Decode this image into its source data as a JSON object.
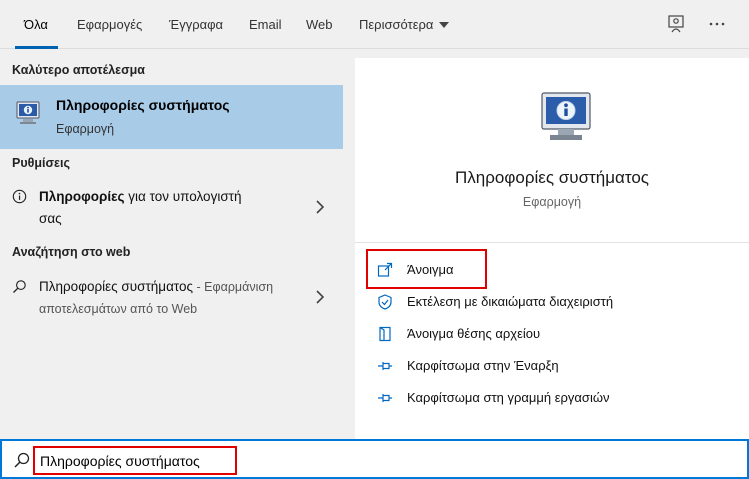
{
  "tabs": [
    {
      "label": "Όλα",
      "active": true
    },
    {
      "label": "Εφαρμογές"
    },
    {
      "label": "Έγγραφα"
    },
    {
      "label": "Email"
    },
    {
      "label": "Web"
    },
    {
      "label": "Περισσότερα"
    }
  ],
  "left": {
    "best_match_header": "Καλύτερο αποτέλεσμα",
    "best_match": {
      "title": "Πληροφορίες συστήματος",
      "subtitle": "Εφαρμογή"
    },
    "settings_header": "Ρυθμίσεις",
    "settings_item": {
      "bold": "Πληροφορίες",
      "rest": " για τον υπολογιστή",
      "line2": "σας"
    },
    "web_header": "Αναζήτηση στο web",
    "web_item": {
      "query": "Πληροφορίες συστήματος",
      "hint": " - Εφαρμάνιση",
      "line2": "αποτελεσμάτων από το Web"
    }
  },
  "right": {
    "title": "Πληροφορίες συστήματος",
    "subtitle": "Εφαρμογή",
    "actions": [
      {
        "label": "Άνοιγμα",
        "icon": "open-icon"
      },
      {
        "label": "Εκτέλεση με δικαιώματα διαχειριστή",
        "icon": "shield-icon"
      },
      {
        "label": "Άνοιγμα θέσης αρχείου",
        "icon": "folder-location-icon"
      },
      {
        "label": "Καρφίτσωμα στην Έναρξη",
        "icon": "pin-icon"
      },
      {
        "label": "Καρφίτσωμα στη γραμμή εργασιών",
        "icon": "pin-icon"
      }
    ]
  },
  "search": {
    "value": "Πληροφορίες συστήματος"
  },
  "colors": {
    "accent": "#0078d7",
    "highlight": "#a8cbe8",
    "annotation": "#e00000"
  }
}
